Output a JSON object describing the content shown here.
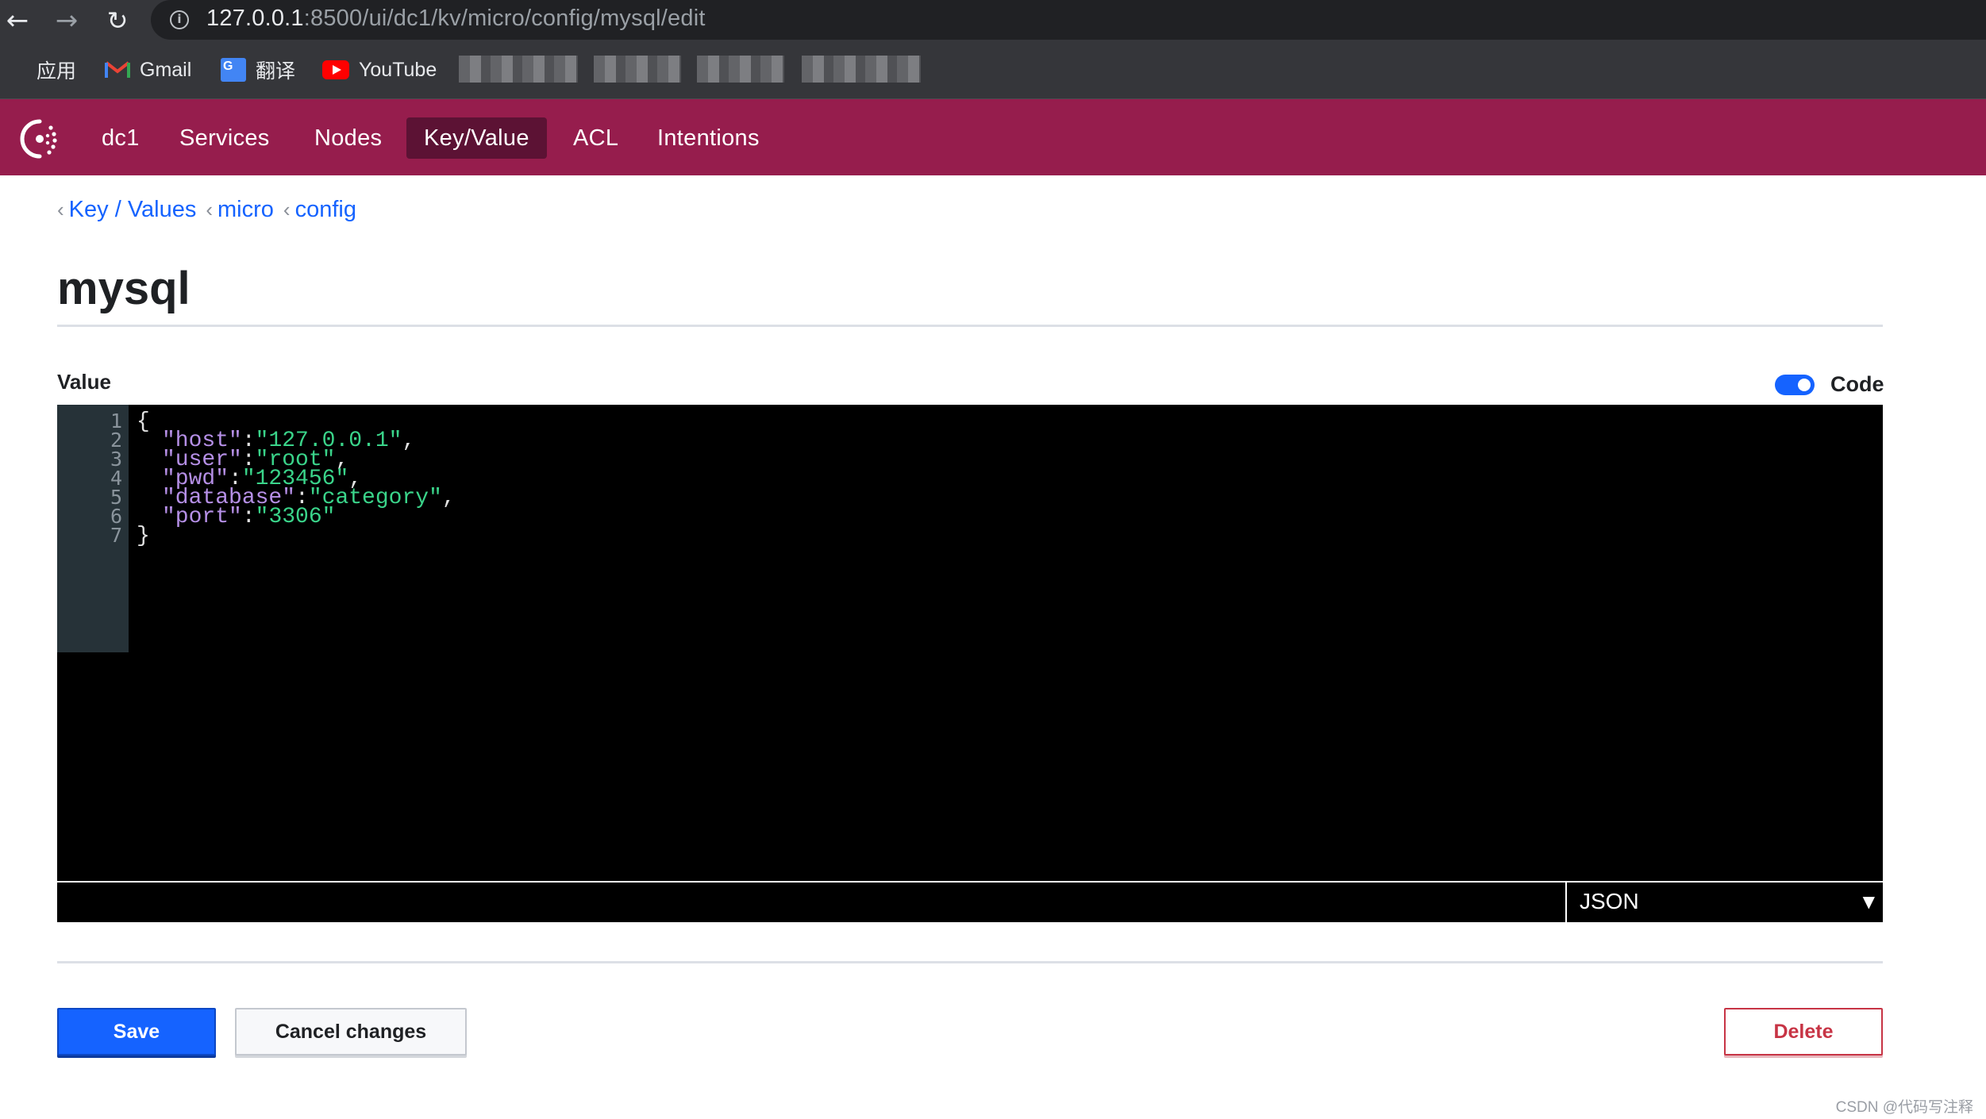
{
  "browser": {
    "url_host": "127.0.0.1",
    "url_rest": ":8500/ui/dc1/kv/micro/config/mysql/edit",
    "bookmarks": [
      "应用",
      "Gmail",
      "翻译",
      "YouTube"
    ]
  },
  "header": {
    "datacenter": "dc1",
    "nav": [
      "Services",
      "Nodes",
      "Key/Value",
      "ACL",
      "Intentions"
    ],
    "active": "Key/Value"
  },
  "breadcrumb": [
    "Key / Values",
    "micro",
    "config"
  ],
  "page": {
    "title": "mysql",
    "value_label": "Value",
    "code_toggle_label": "Code",
    "code_toggle_on": true
  },
  "editor": {
    "line_numbers": [
      "1",
      "2",
      "3",
      "4",
      "5",
      "6",
      "7"
    ],
    "open_brace": "{",
    "close_brace": "}",
    "entries": [
      {
        "key": "\"host\"",
        "value": "\"127.0.0.1\"",
        "comma": ","
      },
      {
        "key": "\"user\"",
        "value": "\"root\"",
        "comma": ","
      },
      {
        "key": "\"pwd\"",
        "value": "\"123456\"",
        "comma": ","
      },
      {
        "key": "\"database\"",
        "value": "\"category\"",
        "comma": ","
      },
      {
        "key": "\"port\"",
        "value": "\"3306\"",
        "comma": ""
      }
    ],
    "mode": "JSON"
  },
  "actions": {
    "save": "Save",
    "cancel": "Cancel changes",
    "delete": "Delete"
  },
  "watermark": "CSDN @代码写注释",
  "colors": {
    "brand": "#961d4d",
    "active_nav": "#5c1234",
    "primary": "#1563ff",
    "danger": "#c73445",
    "json_key": "#b58fe6",
    "json_string": "#3ad48a"
  }
}
